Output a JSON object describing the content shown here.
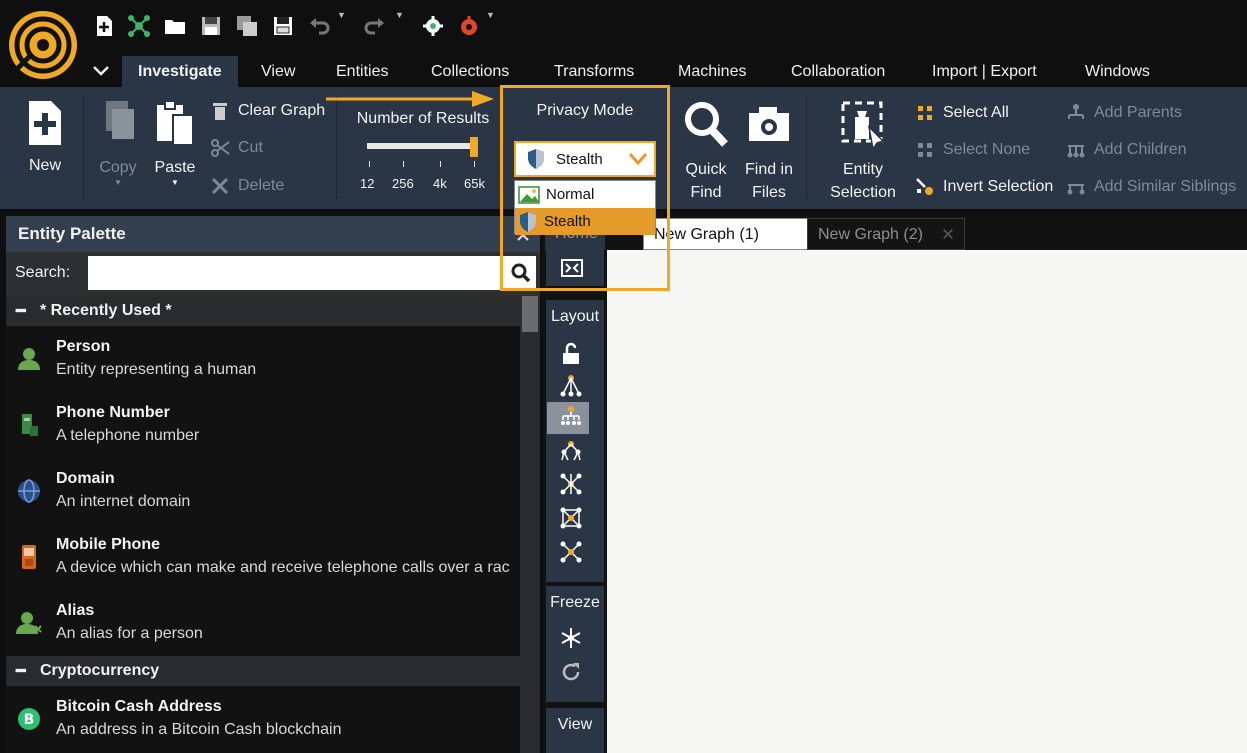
{
  "app": {
    "quick_access": [
      "new-icon",
      "network-icon",
      "open-icon",
      "save-icon",
      "save-as-icon",
      "save-disk-icon",
      "undo-icon",
      "redo-icon",
      "settings-icon",
      "debug-icon"
    ]
  },
  "ribbon_tabs": [
    {
      "label": "Investigate",
      "active": true
    },
    {
      "label": "View"
    },
    {
      "label": "Entities"
    },
    {
      "label": "Collections"
    },
    {
      "label": "Transforms"
    },
    {
      "label": "Machines"
    },
    {
      "label": "Collaboration"
    },
    {
      "label": "Import | Export"
    },
    {
      "label": "Windows"
    }
  ],
  "ribbon": {
    "new": "New",
    "copy": "Copy",
    "paste": "Paste",
    "clear_graph": "Clear Graph",
    "cut": "Cut",
    "delete": "Delete",
    "number_of_results": {
      "label": "Number of Results",
      "ticks": [
        "12",
        "256",
        "4k",
        "65k"
      ],
      "value": "65k"
    },
    "privacy_mode": {
      "label": "Privacy Mode",
      "selected": "Stealth",
      "options": [
        "Normal",
        "Stealth"
      ]
    },
    "quick_find": [
      "Quick",
      "Find"
    ],
    "find_in_files": [
      "Find in",
      "Files"
    ],
    "entity_selection": [
      "Entity",
      "Selection"
    ],
    "select_all": "Select All",
    "select_none": "Select None",
    "invert_selection": "Invert Selection",
    "add_parents": "Add Parents",
    "add_children": "Add Children",
    "add_similar_siblings": "Add Similar Siblings"
  },
  "palette": {
    "title": "Entity Palette",
    "search_label": "Search:",
    "search_value": "",
    "groups": [
      {
        "name": "* Recently Used *",
        "items": [
          {
            "name": "Person",
            "desc": "Entity representing a human",
            "icon": "person-icon"
          },
          {
            "name": "Phone Number",
            "desc": "A telephone number",
            "icon": "phone-icon"
          },
          {
            "name": "Domain",
            "desc": "An internet domain",
            "icon": "domain-icon"
          },
          {
            "name": "Mobile Phone",
            "desc": "A device which can make and receive telephone calls over a rac",
            "icon": "mobile-phone-icon"
          },
          {
            "name": "Alias",
            "desc": "An alias for a person",
            "icon": "alias-icon"
          }
        ]
      },
      {
        "name": "Cryptocurrency",
        "items": [
          {
            "name": "Bitcoin Cash Address",
            "desc": "An address in a Bitcoin Cash blockchain",
            "icon": "bitcoin-cash-icon"
          }
        ]
      }
    ]
  },
  "graph_toolbar": {
    "layout": "Layout",
    "freeze": "Freeze",
    "view": "View"
  },
  "graph_tabs": [
    {
      "label": "Home"
    },
    {
      "label": "New Graph (1)",
      "active": true
    },
    {
      "label": "New Graph (2)"
    }
  ],
  "colors": {
    "accent": "#f0a925",
    "ribbon_bg": "#2a3646",
    "panel_bg": "#121212",
    "selected_option": "#e49b2a"
  }
}
